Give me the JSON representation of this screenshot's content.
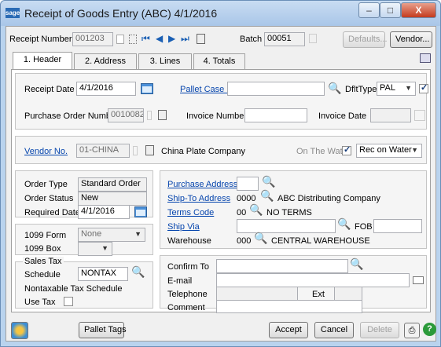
{
  "window": {
    "app_badge": "sage",
    "title": "Receipt of Goods Entry (ABC) 4/1/2016",
    "minimize": "–",
    "maximize": "□",
    "close": "X"
  },
  "header": {
    "receipt_number_label": "Receipt Number",
    "receipt_number": "001203",
    "batch_label": "Batch",
    "batch": "00051",
    "defaults_button": "Defaults...",
    "vendor_button": "Vendor..."
  },
  "tabs": [
    {
      "label": "1. Header"
    },
    {
      "label": "2. Address"
    },
    {
      "label": "3. Lines"
    },
    {
      "label": "4. Totals"
    }
  ],
  "form": {
    "receipt_date_label": "Receipt Date",
    "receipt_date": "4/1/2016",
    "pallet_case_id_label": "Pallet Case ID",
    "pallet_case_id": "",
    "dflt_type_label": "DfltType",
    "dflt_type": "PAL",
    "po_number_label": "Purchase Order Number",
    "po_number": "0010082",
    "invoice_number_label": "Invoice Number",
    "invoice_number": "",
    "invoice_date_label": "Invoice Date",
    "invoice_date": "",
    "vendor_no_label": "Vendor No.",
    "vendor_no": "01-CHINA",
    "vendor_name": "China Plate Company",
    "on_the_water_label": "On The Water",
    "rec_on_water": "Rec on Water",
    "order_type_label": "Order Type",
    "order_type": "Standard Order",
    "order_status_label": "Order Status",
    "order_status": "New",
    "required_date_label": "Required Date",
    "required_date": "4/1/2016",
    "form_1099_label": "1099 Form",
    "form_1099": "None",
    "box_1099_label": "1099 Box",
    "box_1099": "",
    "sales_tax_label": "Sales Tax",
    "schedule_label": "Schedule",
    "schedule": "NONTAX",
    "schedule_desc": "Nontaxable Tax Schedule",
    "use_tax_label": "Use Tax",
    "purchase_address_label": "Purchase Address",
    "purchase_address": "",
    "ship_to_label": "Ship-To Address",
    "ship_to": "0000",
    "ship_to_name": "ABC Distributing Company",
    "terms_code_label": "Terms Code",
    "terms_code": "00",
    "terms_desc": "NO TERMS",
    "ship_via_label": "Ship Via",
    "ship_via": "",
    "fob_label": "FOB",
    "fob": "",
    "warehouse_label": "Warehouse",
    "warehouse": "000",
    "warehouse_name": "CENTRAL WAREHOUSE",
    "confirm_to_label": "Confirm To",
    "confirm_to": "",
    "email_label": "E-mail",
    "email": "",
    "telephone_label": "Telephone",
    "telephone": "",
    "ext_label": "Ext",
    "ext": "",
    "comment_label": "Comment",
    "comment": ""
  },
  "footer": {
    "pallet_tags_button": "Pallet Tags",
    "accept_button": "Accept",
    "cancel_button": "Cancel",
    "delete_button": "Delete"
  },
  "colors": {
    "link": "#0645ad",
    "titlebar": "#a9c6e8",
    "close": "#c43b1e"
  }
}
